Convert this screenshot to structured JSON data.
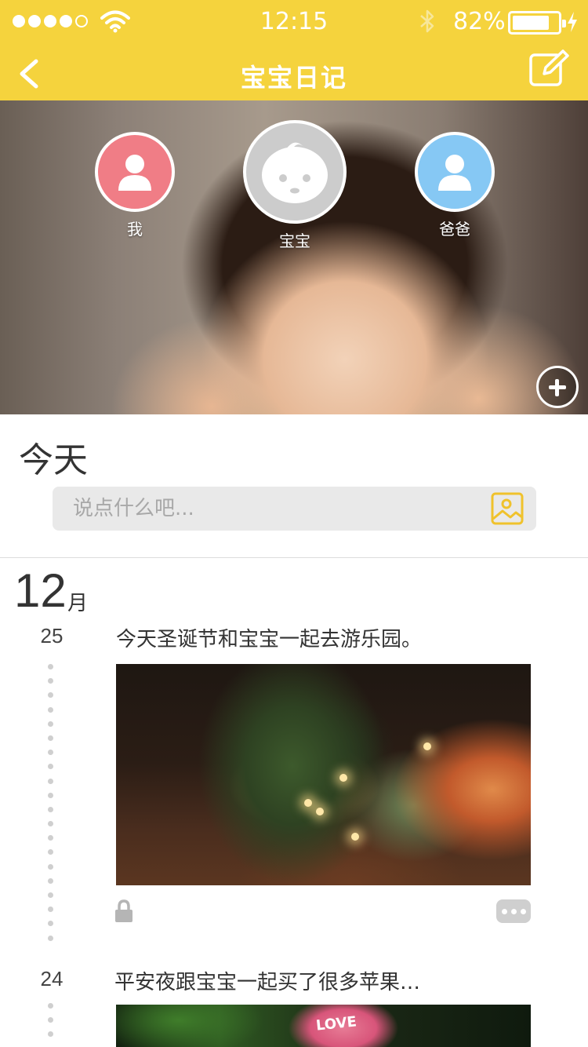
{
  "status_bar": {
    "time": "12:15",
    "battery_percent": "82%",
    "battery_level": 0.82,
    "signal_bars_filled": 4,
    "signal_bars_total": 5,
    "icons": [
      "signal-icon",
      "wifi-icon",
      "bluetooth-icon",
      "battery-icon",
      "charging-icon"
    ]
  },
  "nav": {
    "title": "宝宝日记",
    "back_icon": "chevron-left-icon",
    "edit_icon": "edit-icon"
  },
  "hero": {
    "profiles": [
      {
        "name": "我",
        "color": "#f07d86",
        "icon": "person-icon"
      },
      {
        "name": "宝宝",
        "color": "#cccccc",
        "icon": "baby-face-icon"
      },
      {
        "name": "爸爸",
        "color": "#86c8f4",
        "icon": "person-icon"
      }
    ],
    "add_icon": "plus-circle-icon"
  },
  "today": {
    "title": "今天",
    "input_placeholder": "说点什么吧...",
    "image_icon": "image-icon"
  },
  "timeline": {
    "month_number": "12",
    "month_unit": "月",
    "entries": [
      {
        "day": "25",
        "text": "今天圣诞节和宝宝一起去游乐园。",
        "photo_icon": "photo-icon",
        "lock_icon": "lock-icon",
        "more_icon": "more-icon"
      },
      {
        "day": "24",
        "text": "平安夜跟宝宝一起买了很多苹果…",
        "photo_text": "LOVE"
      }
    ]
  },
  "colors": {
    "accent": "#f5d33d",
    "input_bg": "#e9e9e9",
    "dot": "#cfcfcf",
    "text": "#333333"
  }
}
